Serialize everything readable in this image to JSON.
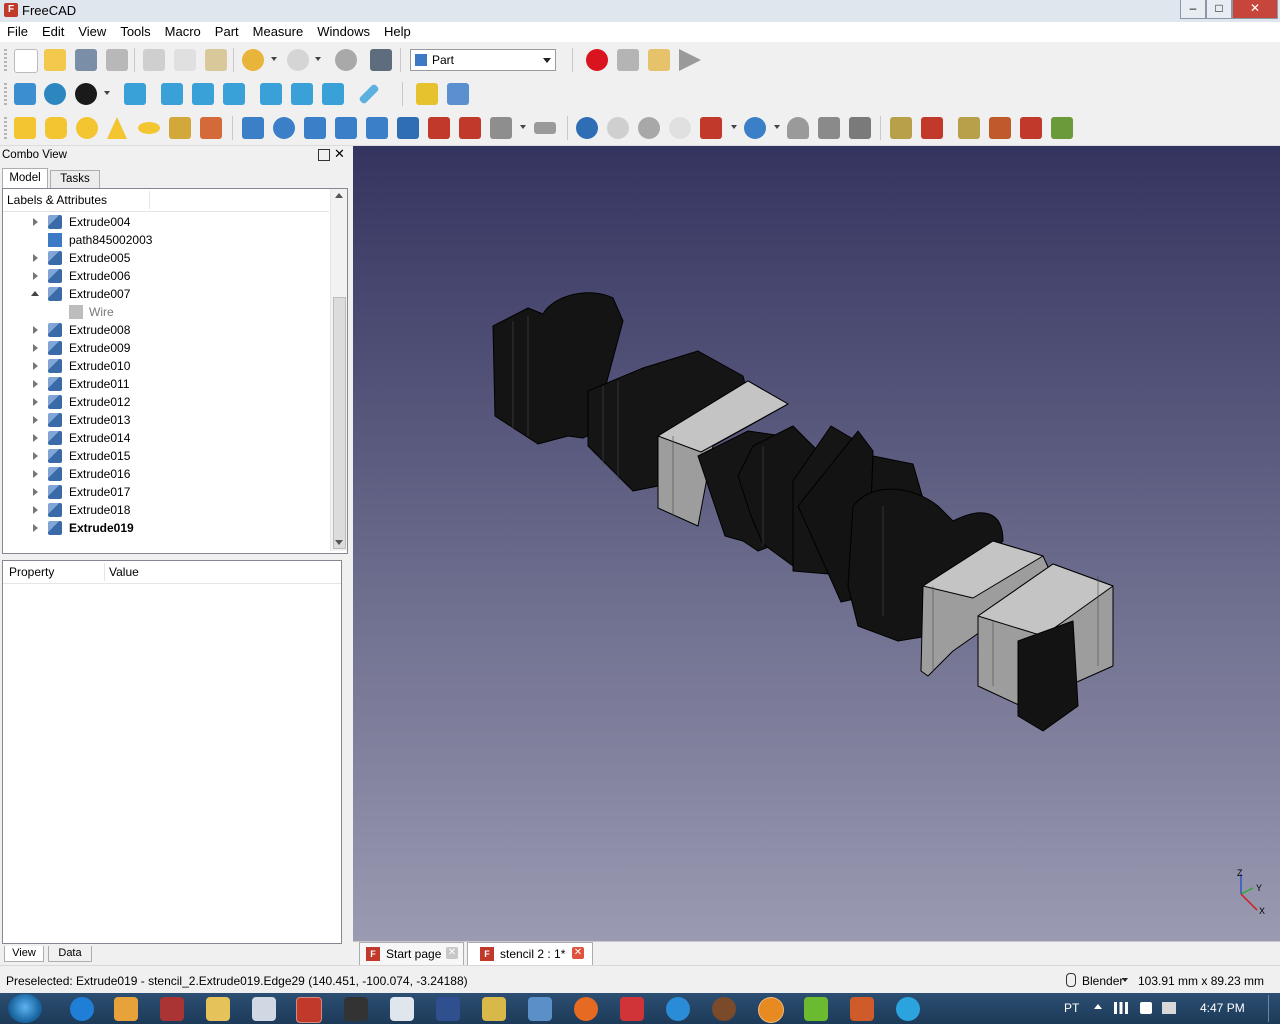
{
  "window": {
    "title": "FreeCAD",
    "app_icon_letter": "F",
    "controls": [
      "–",
      "□",
      "✕"
    ]
  },
  "menubar": [
    "File",
    "Edit",
    "View",
    "Tools",
    "Macro",
    "Part",
    "Measure",
    "Windows",
    "Help"
  ],
  "workbench": {
    "selected": "Part"
  },
  "combo_view": {
    "title": "Combo View",
    "tabs": [
      "Model",
      "Tasks"
    ],
    "tree_header": "Labels & Attributes",
    "tree_items": [
      {
        "label": "Extrude004",
        "expander": "closed",
        "icon": "extrude-icon",
        "child": false,
        "bold": false
      },
      {
        "label": "path845002003",
        "expander": "none",
        "icon": "part-cube-icon",
        "child": false,
        "bold": false
      },
      {
        "label": "Extrude005",
        "expander": "closed",
        "icon": "extrude-icon",
        "child": false,
        "bold": false
      },
      {
        "label": "Extrude006",
        "expander": "closed",
        "icon": "extrude-icon",
        "child": false,
        "bold": false
      },
      {
        "label": "Extrude007",
        "expander": "open",
        "icon": "extrude-icon",
        "child": false,
        "bold": false
      },
      {
        "label": "Wire",
        "expander": "none",
        "icon": "wire-icon",
        "child": true,
        "bold": false
      },
      {
        "label": "Extrude008",
        "expander": "closed",
        "icon": "extrude-icon",
        "child": false,
        "bold": false
      },
      {
        "label": "Extrude009",
        "expander": "closed",
        "icon": "extrude-icon",
        "child": false,
        "bold": false
      },
      {
        "label": "Extrude010",
        "expander": "closed",
        "icon": "extrude-icon",
        "child": false,
        "bold": false
      },
      {
        "label": "Extrude011",
        "expander": "closed",
        "icon": "extrude-icon",
        "child": false,
        "bold": false
      },
      {
        "label": "Extrude012",
        "expander": "closed",
        "icon": "extrude-icon",
        "child": false,
        "bold": false
      },
      {
        "label": "Extrude013",
        "expander": "closed",
        "icon": "extrude-icon",
        "child": false,
        "bold": false
      },
      {
        "label": "Extrude014",
        "expander": "closed",
        "icon": "extrude-icon",
        "child": false,
        "bold": false
      },
      {
        "label": "Extrude015",
        "expander": "closed",
        "icon": "extrude-icon",
        "child": false,
        "bold": false
      },
      {
        "label": "Extrude016",
        "expander": "closed",
        "icon": "extrude-icon",
        "child": false,
        "bold": false
      },
      {
        "label": "Extrude017",
        "expander": "closed",
        "icon": "extrude-icon",
        "child": false,
        "bold": false
      },
      {
        "label": "Extrude018",
        "expander": "closed",
        "icon": "extrude-icon",
        "child": false,
        "bold": false
      },
      {
        "label": "Extrude019",
        "expander": "closed",
        "icon": "extrude-icon",
        "child": false,
        "bold": true
      }
    ],
    "property_header": {
      "property": "Property",
      "value": "Value"
    },
    "bottom_tabs": [
      "View",
      "Data"
    ]
  },
  "view3d": {
    "axis_labels": {
      "z": "Z",
      "y": "Y",
      "x": "X"
    },
    "colors": {
      "bg_top": "#343460",
      "bg_bottom": "#9a9ab2",
      "dark_face": "#141414",
      "light_face": "#9d9d9d"
    }
  },
  "doc_tabs": [
    {
      "label": "Start page",
      "active": false
    },
    {
      "label": "stencil 2 : 1*",
      "active": true
    }
  ],
  "statusbar": {
    "message": "Preselected: Extrude019 - stencil_2.Extrude019.Edge29 (140.451, -100.074, -3.24188)",
    "navigation": "Blender",
    "dimensions": "103.91 mm x 89.23 mm"
  },
  "taskbar": {
    "language": "PT",
    "time": "4:47 PM"
  },
  "colors": {
    "record": "#d9141e",
    "accent": "#3d79c5",
    "freecad_red": "#c0392b"
  }
}
